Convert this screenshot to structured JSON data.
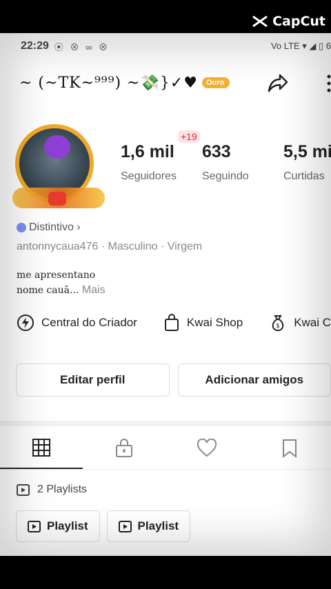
{
  "overlay": {
    "brand": "CapCut"
  },
  "status": {
    "time": "22:29",
    "icons": "⦿ ⊗ ∞ ⊗",
    "right": "Vo LTE ▾ ◢ ▯ 6"
  },
  "profile": {
    "display_name": "~ (~TK~⁹⁹⁹) ~💸}✓♥",
    "tier_badge": "Ouro",
    "stats": [
      {
        "value": "1,6 mil",
        "label": "Seguidores"
      },
      {
        "value": "633",
        "label": "Seguindo"
      },
      {
        "value": "5,5 mil",
        "label": "Curtidas"
      }
    ],
    "follower_delta": "+19",
    "distintivo": "Distintivo ›",
    "meta": "antonnycaua476 · Masculino · Virgem",
    "bio_line1": "me apresentano",
    "bio_line2": "nome cauã...",
    "bio_more": "Mais"
  },
  "shortcuts": [
    {
      "label": "Central do Criador",
      "icon": "lightning-icon"
    },
    {
      "label": "Kwai Shop",
      "icon": "shopping-bag-icon"
    },
    {
      "label": "Kwai C",
      "icon": "money-bag-icon"
    }
  ],
  "buttons": {
    "edit": "Editar perfil",
    "add_friends": "Adicionar amigos"
  },
  "tabs": [
    "grid-icon",
    "lock-icon",
    "heart-icon",
    "bookmark-icon"
  ],
  "playlists": {
    "count_label": "2 Playlists",
    "items": [
      "Playlist",
      "Playlist"
    ]
  },
  "colors": {
    "badge": "#f1b233",
    "accent_red": "#e5273b"
  }
}
